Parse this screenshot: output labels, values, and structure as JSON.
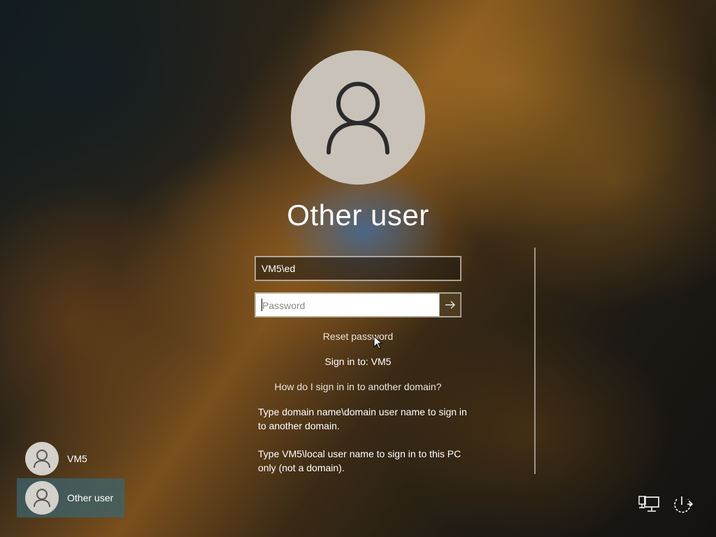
{
  "login": {
    "user_name": "Other user",
    "username_value": "VM5\\ed",
    "password_placeholder": "Password",
    "reset_password": "Reset password",
    "sign_in_to": "Sign in to: VM5",
    "how_do_i": "How do I sign in in to another domain?",
    "info_line_1": "Type domain name\\domain user name to sign in to another domain.",
    "info_line_2": "Type VM5\\local user name to sign in to this PC only (not a domain)."
  },
  "user_list": [
    {
      "label": "VM5",
      "selected": false
    },
    {
      "label": "Other user",
      "selected": true
    }
  ],
  "icons": {
    "avatar": "user-silhouette-icon",
    "submit": "arrow-right-icon",
    "network": "network-icon",
    "power": "power-icon"
  },
  "colors": {
    "selected_tile": "#3c646e",
    "avatar_bg": "#c9c2b9"
  }
}
